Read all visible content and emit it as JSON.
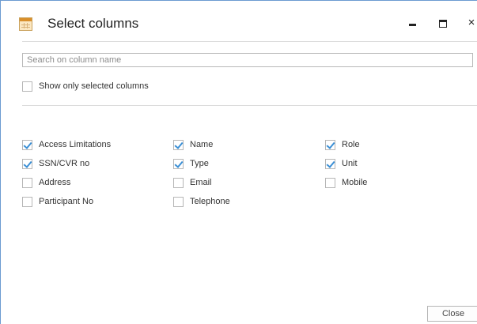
{
  "window": {
    "title": "Select columns",
    "controls": {
      "minimize": "minimize-icon",
      "maximize": "maximize-icon",
      "close": "×"
    }
  },
  "search": {
    "placeholder": "Search on column name",
    "value": ""
  },
  "show_only_selected": {
    "label": "Show only selected columns",
    "checked": false
  },
  "columns": [
    {
      "label": "Access Limitations",
      "checked": true
    },
    {
      "label": "Name",
      "checked": true
    },
    {
      "label": "Role",
      "checked": true
    },
    {
      "label": "SSN/CVR no",
      "checked": true
    },
    {
      "label": "Type",
      "checked": true
    },
    {
      "label": "Unit",
      "checked": true
    },
    {
      "label": "Address",
      "checked": false
    },
    {
      "label": "Email",
      "checked": false
    },
    {
      "label": "Mobile",
      "checked": false
    },
    {
      "label": "Participant No",
      "checked": false
    },
    {
      "label": "Telephone",
      "checked": false
    }
  ],
  "footer": {
    "close_label": "Close"
  },
  "colors": {
    "border": "#6b9bd1",
    "check": "#3b8fd5"
  }
}
